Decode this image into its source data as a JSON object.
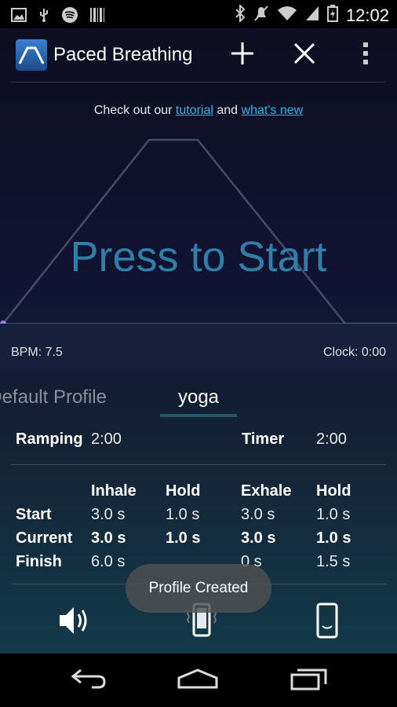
{
  "status_bar": {
    "time": "12:02",
    "left_icons": [
      "image-icon",
      "usb-debug-icon",
      "spotify-icon",
      "barcode-icon"
    ],
    "right_icons": [
      "bluetooth-icon",
      "mute-icon",
      "wifi-icon",
      "signal-icon",
      "battery-icon"
    ]
  },
  "action_bar": {
    "title": "Paced Breathing",
    "actions": [
      "add-icon",
      "close-icon",
      "overflow-menu-icon"
    ]
  },
  "links": {
    "prefix": "Check out our ",
    "tutorial": "tutorial",
    "and": " and ",
    "whats_new": "what's new"
  },
  "graph": {
    "prompt": "Press to Start",
    "bpm": "BPM: 7.5",
    "clock": "Clock: 0:00"
  },
  "profiles": {
    "default": "Default Profile",
    "active": "yoga"
  },
  "settings": {
    "ramping_label": "Ramping",
    "ramping_value": "2:00",
    "timer_label": "Timer",
    "timer_value": "2:00"
  },
  "table": {
    "headers": [
      "Inhale",
      "Hold",
      "Exhale",
      "Hold"
    ],
    "rows": [
      {
        "label": "Start",
        "values": [
          "3.0 s",
          "1.0 s",
          "3.0 s",
          "1.0 s"
        ]
      },
      {
        "label": "Current",
        "values": [
          "3.0 s",
          "1.0 s",
          "3.0 s",
          "1.0 s"
        ]
      },
      {
        "label": "Finish",
        "values": [
          "6.0 s",
          "",
          "0 s",
          "1.5 s"
        ]
      }
    ]
  },
  "toast": "Profile Created",
  "bottom_controls": [
    "volume-icon",
    "vibrate-icon",
    "screen-icon"
  ],
  "nav": [
    "back-icon",
    "home-icon",
    "recents-icon"
  ],
  "colors": {
    "accent": "#33b5e5",
    "prompt": "#2f7fa8",
    "background_top": "#0e0e22",
    "background_bottom": "#123a4a"
  }
}
